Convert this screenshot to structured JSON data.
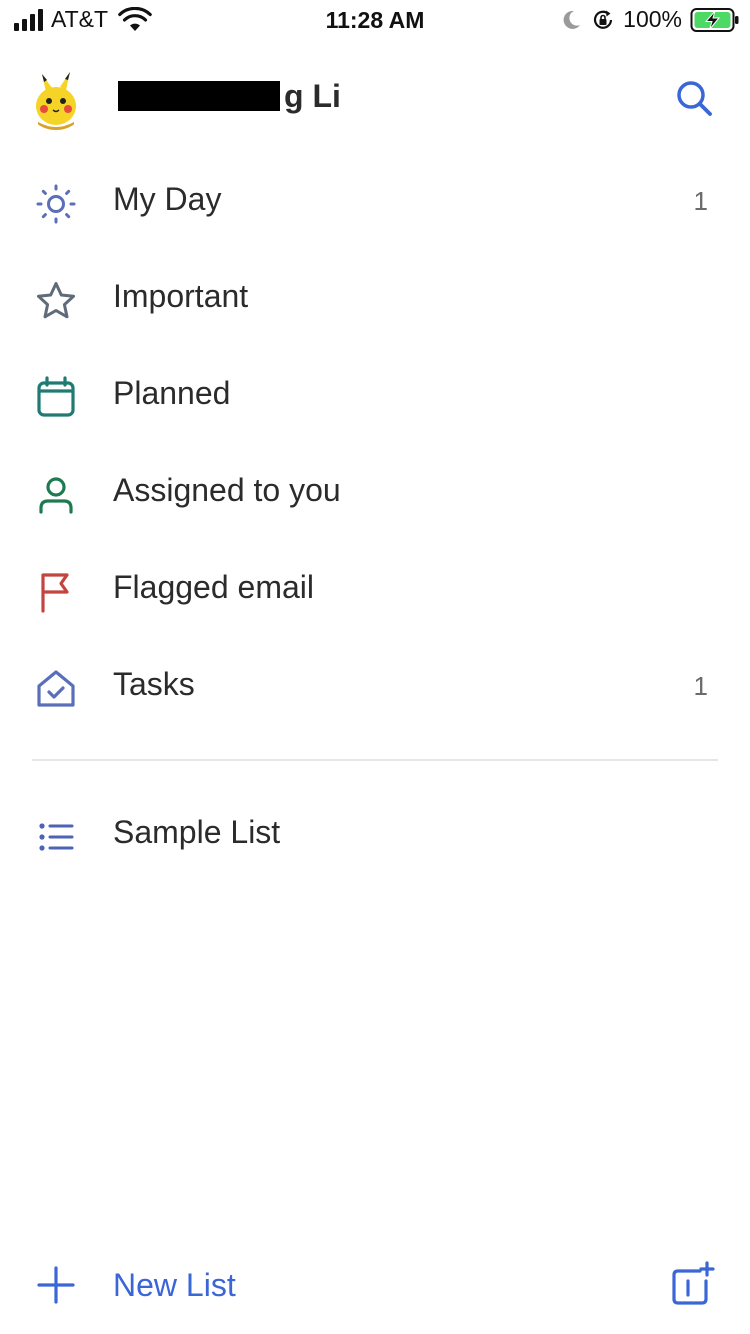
{
  "status_bar": {
    "carrier": "AT&T",
    "time": "11:28 AM",
    "battery": "100%",
    "icons": [
      "signal-icon",
      "wifi-icon",
      "moon-icon",
      "orientation-lock-icon",
      "battery-charging-icon"
    ]
  },
  "header": {
    "user_name_visible": "g Li",
    "avatar_icon": "pikachu-avatar",
    "search_icon": "search-icon"
  },
  "menu": {
    "items": [
      {
        "label": "My Day",
        "count": "1",
        "icon": "sun-icon",
        "color": "#5a6fb8"
      },
      {
        "label": "Important",
        "count": "",
        "icon": "star-icon",
        "color": "#5f6b78"
      },
      {
        "label": "Planned",
        "count": "",
        "icon": "calendar-icon",
        "color": "#1e7a72"
      },
      {
        "label": "Assigned to you",
        "count": "",
        "icon": "person-icon",
        "color": "#1f7a52"
      },
      {
        "label": "Flagged email",
        "count": "",
        "icon": "flag-icon",
        "color": "#c2453f"
      },
      {
        "label": "Tasks",
        "count": "1",
        "icon": "house-check-icon",
        "color": "#5a6fb8"
      }
    ]
  },
  "lists": {
    "items": [
      {
        "label": "Sample List",
        "icon": "list-icon",
        "color": "#4c63b6"
      }
    ]
  },
  "footer": {
    "new_list_label": "New List",
    "new_list_icon": "plus-icon",
    "new_group_icon": "new-group-icon",
    "accent": "#3a66d6"
  }
}
